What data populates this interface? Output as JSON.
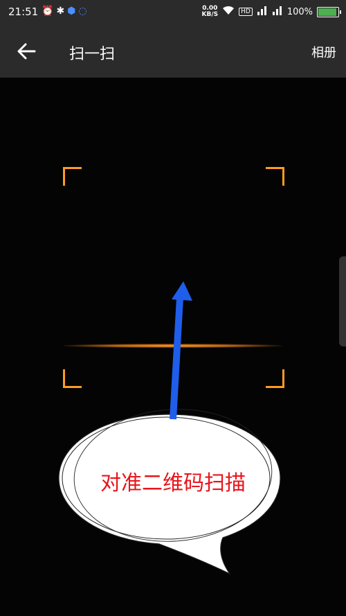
{
  "status_bar": {
    "time": "21:51",
    "speed_value": "0.00",
    "speed_unit": "KB/S",
    "hd": "HD",
    "battery": "100%",
    "battery_level": 1.0
  },
  "header": {
    "title": "扫一扫",
    "album_label": "相册"
  },
  "annotation": {
    "bubble_text": "对准二维码扫描"
  },
  "colors": {
    "scan_frame": "#ff9b21",
    "arrow": "#1f5eea",
    "bubble_text": "#e8141b",
    "battery": "#4caf50"
  }
}
